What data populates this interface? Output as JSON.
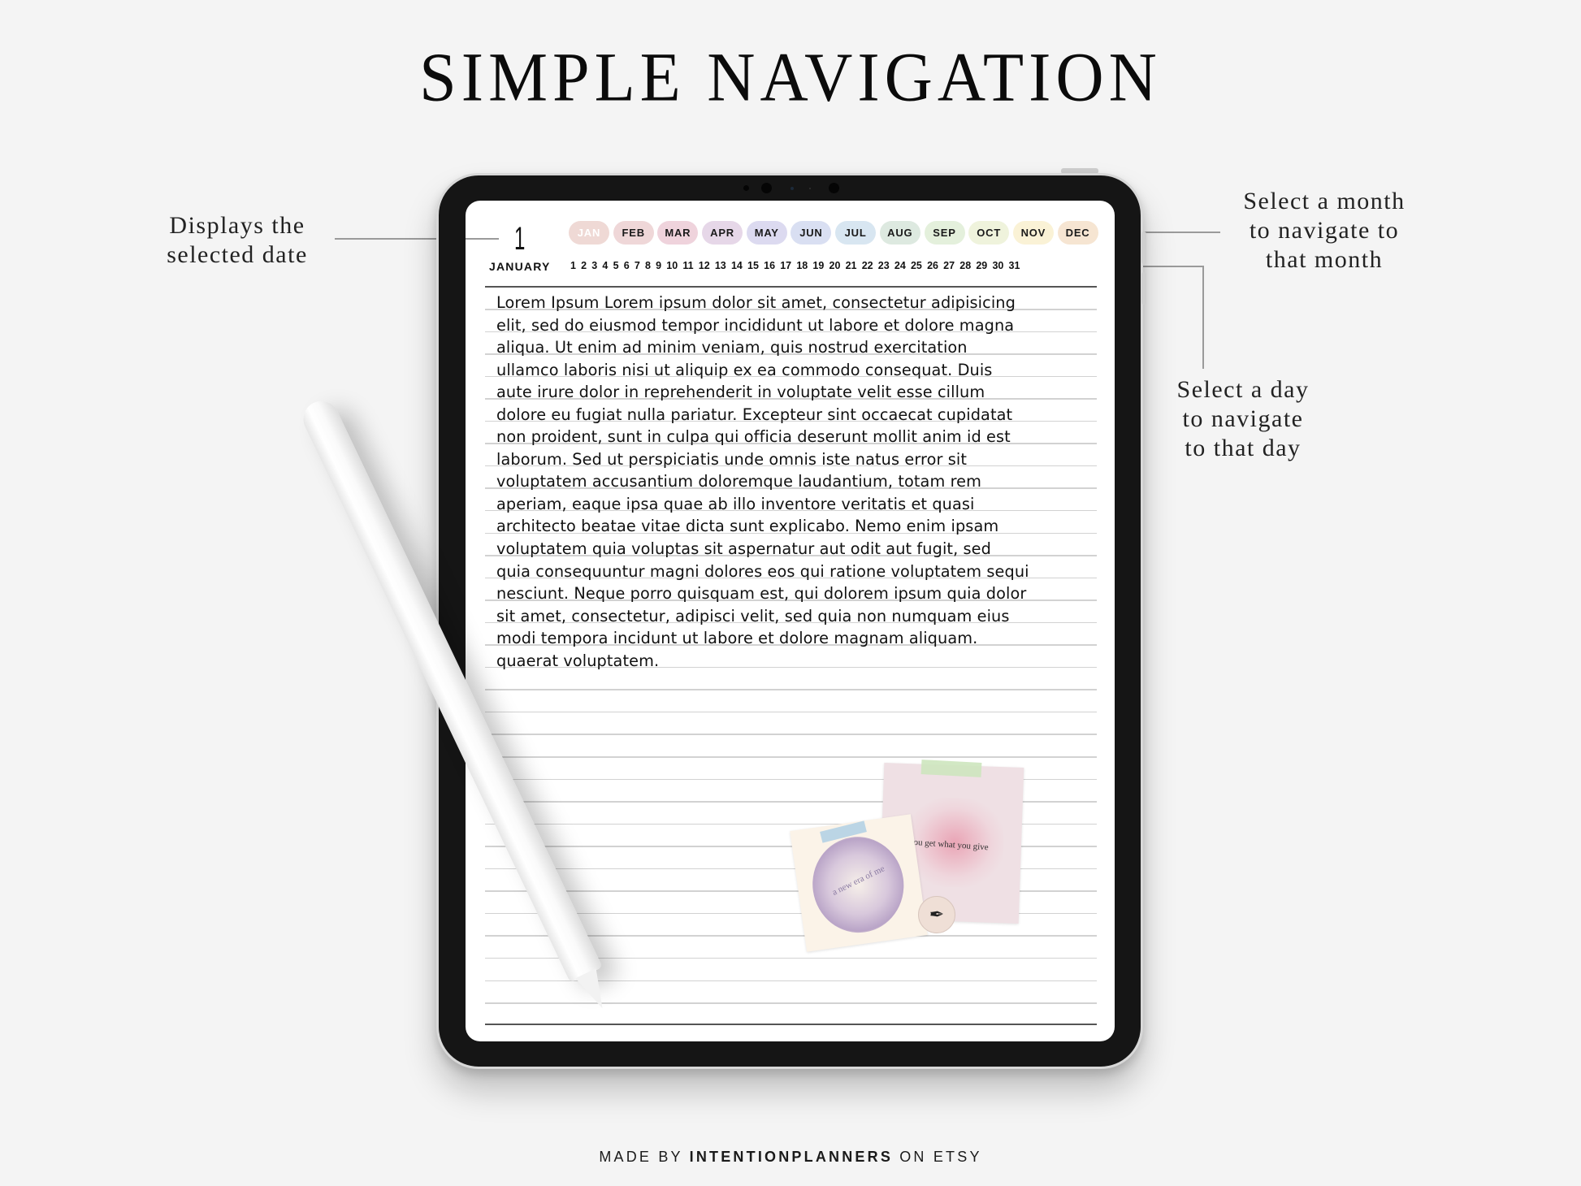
{
  "title": "SIMPLE NAVIGATION",
  "footer": {
    "prefix": "MADE BY",
    "brand": "INTENTIONPLANNERS",
    "suffix": "ON ETSY"
  },
  "annotations": {
    "date": [
      "Displays the",
      "selected date"
    ],
    "month": [
      "Select a month",
      "to navigate to",
      "that month"
    ],
    "day": [
      "Select a day",
      "to navigate",
      "to that day"
    ]
  },
  "planner": {
    "selected_day": "1",
    "selected_month": "JANUARY",
    "months": [
      {
        "label": "JAN",
        "color": "#efd9d5",
        "active": true
      },
      {
        "label": "FEB",
        "color": "#efd7d8",
        "active": false
      },
      {
        "label": "MAR",
        "color": "#efd3dc",
        "active": false
      },
      {
        "label": "APR",
        "color": "#e6d7e8",
        "active": false
      },
      {
        "label": "MAY",
        "color": "#dcdaf0",
        "active": false
      },
      {
        "label": "JUN",
        "color": "#d9dff2",
        "active": false
      },
      {
        "label": "JUL",
        "color": "#d8e6f1",
        "active": false
      },
      {
        "label": "AUG",
        "color": "#dde9e0",
        "active": false
      },
      {
        "label": "SEP",
        "color": "#e4f0dc",
        "active": false
      },
      {
        "label": "OCT",
        "color": "#eff3dc",
        "active": false
      },
      {
        "label": "NOV",
        "color": "#faf2d6",
        "active": false
      },
      {
        "label": "DEC",
        "color": "#f6e5d2",
        "active": false
      }
    ],
    "days": [
      "1",
      "2",
      "3",
      "4",
      "5",
      "6",
      "7",
      "8",
      "9",
      "10",
      "11",
      "12",
      "13",
      "14",
      "15",
      "16",
      "17",
      "18",
      "19",
      "20",
      "21",
      "22",
      "23",
      "24",
      "25",
      "26",
      "27",
      "28",
      "29",
      "30",
      "31"
    ],
    "note_lines": [
      "Lorem Ipsum Lorem ipsum dolor sit amet, consectetur adipisicing",
      "elit, sed do eiusmod tempor incididunt ut labore et dolore magna",
      "aliqua. Ut enim ad minim veniam, quis nostrud exercitation",
      "ullamco laboris nisi ut aliquip ex ea commodo consequat. Duis",
      "aute irure dolor in reprehenderit in voluptate velit esse cillum",
      "dolore eu fugiat nulla pariatur. Excepteur sint occaecat cupidatat",
      "non proident, sunt in culpa qui officia deserunt mollit anim id est",
      "laborum. Sed ut perspiciatis unde omnis iste natus error sit",
      "voluptatem accusantium doloremque laudantium, totam rem",
      "aperiam, eaque ipsa quae ab illo inventore veritatis et quasi",
      "architecto beatae vitae dicta sunt explicabo. Nemo enim ipsam",
      "voluptatem quia voluptas sit aspernatur aut odit aut fugit, sed",
      "quia consequuntur magni dolores eos qui ratione voluptatem sequi",
      "nesciunt. Neque porro quisquam est, qui dolorem ipsum quia dolor",
      "sit amet, consectetur, adipisci velit, sed quia non numquam eius",
      "modi tempora incidunt ut labore et dolore magnam aliquam.",
      "quaerat voluptatem."
    ],
    "stickers": {
      "pink_note": "you get what you give",
      "cream_note": "a new era of me",
      "badge_icon": "pen-signature-icon"
    }
  }
}
